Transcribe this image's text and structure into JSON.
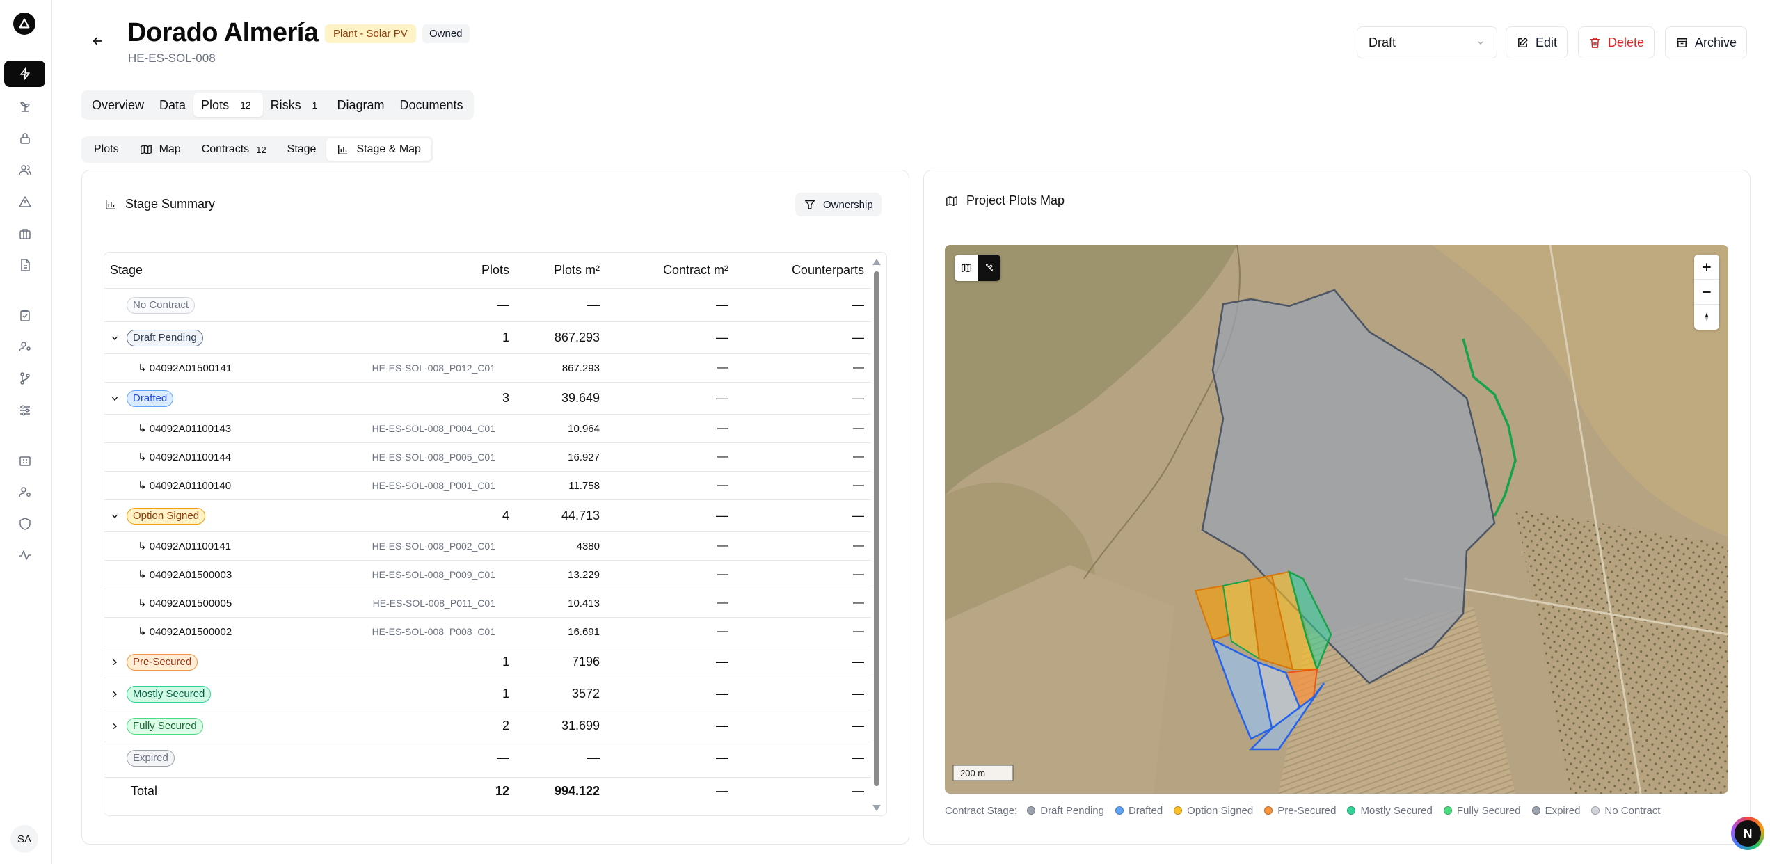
{
  "sidebar": {
    "avatar": "SA"
  },
  "header": {
    "title": "Dorado Almería",
    "type_badge": "Plant - Solar PV",
    "owned_badge": "Owned",
    "code": "HE-ES-SOL-008",
    "status": "Draft",
    "edit_label": "Edit",
    "delete_label": "Delete",
    "archive_label": "Archive"
  },
  "tabs": [
    {
      "label": "Overview",
      "count": ""
    },
    {
      "label": "Data",
      "count": ""
    },
    {
      "label": "Plots",
      "count": "12"
    },
    {
      "label": "Risks",
      "count": "1"
    },
    {
      "label": "Diagram",
      "count": ""
    },
    {
      "label": "Documents",
      "count": ""
    }
  ],
  "subtabs": [
    {
      "label": "Plots",
      "count": ""
    },
    {
      "label": "Map",
      "count": ""
    },
    {
      "label": "Contracts",
      "count": "12"
    },
    {
      "label": "Stage",
      "count": ""
    },
    {
      "label": "Stage & Map",
      "count": ""
    }
  ],
  "summary": {
    "title": "Stage Summary",
    "filter_label": "Ownership",
    "columns": {
      "stage": "Stage",
      "plots": "Plots",
      "m2": "Plots m²",
      "cm2": "Contract m²",
      "cp": "Counterparts"
    },
    "rows": [
      {
        "kind": "group",
        "stage": "No Contract",
        "plots": "—",
        "m2": "—",
        "cm2": "—",
        "cp": "—",
        "expand": ""
      },
      {
        "kind": "group",
        "stage": "Draft Pending",
        "plots": "1",
        "m2": "867.293",
        "cm2": "—",
        "cp": "—",
        "expand": "down"
      },
      {
        "kind": "child",
        "stage": "↳ 04092A01500141",
        "code": "HE-ES-SOL-008_P012_C01",
        "m2": "867.293",
        "cm2": "—",
        "cp": "—"
      },
      {
        "kind": "group",
        "stage": "Drafted",
        "plots": "3",
        "m2": "39.649",
        "cm2": "—",
        "cp": "—",
        "expand": "down"
      },
      {
        "kind": "child",
        "stage": "↳ 04092A01100143",
        "code": "HE-ES-SOL-008_P004_C01",
        "m2": "10.964",
        "cm2": "—",
        "cp": "—"
      },
      {
        "kind": "child",
        "stage": "↳ 04092A01100144",
        "code": "HE-ES-SOL-008_P005_C01",
        "m2": "16.927",
        "cm2": "—",
        "cp": "—"
      },
      {
        "kind": "child",
        "stage": "↳ 04092A01100140",
        "code": "HE-ES-SOL-008_P001_C01",
        "m2": "11.758",
        "cm2": "—",
        "cp": "—"
      },
      {
        "kind": "group",
        "stage": "Option Signed",
        "plots": "4",
        "m2": "44.713",
        "cm2": "—",
        "cp": "—",
        "expand": "down"
      },
      {
        "kind": "child",
        "stage": "↳ 04092A01100141",
        "code": "HE-ES-SOL-008_P002_C01",
        "m2": "4380",
        "cm2": "—",
        "cp": "—"
      },
      {
        "kind": "child",
        "stage": "↳ 04092A01500003",
        "code": "HE-ES-SOL-008_P009_C01",
        "m2": "13.229",
        "cm2": "—",
        "cp": "—"
      },
      {
        "kind": "child",
        "stage": "↳ 04092A01500005",
        "code": "HE-ES-SOL-008_P011_C01",
        "m2": "10.413",
        "cm2": "—",
        "cp": "—"
      },
      {
        "kind": "child",
        "stage": "↳ 04092A01500002",
        "code": "HE-ES-SOL-008_P008_C01",
        "m2": "16.691",
        "cm2": "—",
        "cp": "—"
      },
      {
        "kind": "group",
        "stage": "Pre-Secured",
        "plots": "1",
        "m2": "7196",
        "cm2": "—",
        "cp": "—",
        "expand": "right"
      },
      {
        "kind": "group",
        "stage": "Mostly Secured",
        "plots": "1",
        "m2": "3572",
        "cm2": "—",
        "cp": "—",
        "expand": "right"
      },
      {
        "kind": "group",
        "stage": "Fully Secured",
        "plots": "2",
        "m2": "31.699",
        "cm2": "—",
        "cp": "—",
        "expand": "right"
      },
      {
        "kind": "group",
        "stage": "Expired",
        "plots": "—",
        "m2": "—",
        "cm2": "—",
        "cp": "—",
        "expand": ""
      }
    ],
    "total": {
      "label": "Total",
      "plots": "12",
      "m2": "994.122",
      "cm2": "—",
      "cp": "—"
    }
  },
  "map": {
    "title": "Project Plots Map",
    "scale_label": "200 m",
    "legend_title": "Contract Stage:",
    "legend": [
      {
        "label": "Draft Pending",
        "color": "#9ca3af"
      },
      {
        "label": "Drafted",
        "color": "#60a5fa"
      },
      {
        "label": "Option Signed",
        "color": "#fbbf24"
      },
      {
        "label": "Pre-Secured",
        "color": "#fb923c"
      },
      {
        "label": "Mostly Secured",
        "color": "#34d399"
      },
      {
        "label": "Fully Secured",
        "color": "#4ade80"
      },
      {
        "label": "Expired",
        "color": "#9ca3af"
      },
      {
        "label": "No Contract",
        "color": "#d1d5db"
      }
    ]
  },
  "stage_colors": {
    "No Contract": {
      "bg": "#f9fafb",
      "border": "#d1d5db",
      "fg": "#6b7280"
    },
    "Draft Pending": {
      "bg": "#f1f5f9",
      "border": "#64748b",
      "fg": "#334155"
    },
    "Drafted": {
      "bg": "#dbeafe",
      "border": "#60a5fa",
      "fg": "#1d4ed8"
    },
    "Option Signed": {
      "bg": "#fef3c7",
      "border": "#f59e0b",
      "fg": "#92400e"
    },
    "Pre-Secured": {
      "bg": "#ffedd5",
      "border": "#fb923c",
      "fg": "#9a3412"
    },
    "Mostly Secured": {
      "bg": "#d1fae5",
      "border": "#34d399",
      "fg": "#065f46"
    },
    "Fully Secured": {
      "bg": "#dcfce7",
      "border": "#4ade80",
      "fg": "#166534"
    },
    "Expired": {
      "bg": "#f3f4f6",
      "border": "#9ca3af",
      "fg": "#6b7280"
    }
  },
  "fab_label": "N"
}
